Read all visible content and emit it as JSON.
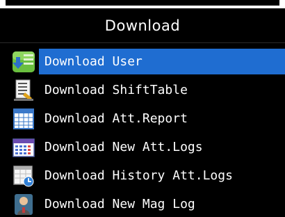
{
  "title": "Download",
  "menu": {
    "items": [
      {
        "label": "Download User",
        "icon": "user-download-icon",
        "selected": true
      },
      {
        "label": "Download ShiftTable",
        "icon": "shift-table-icon",
        "selected": false
      },
      {
        "label": "Download Att.Report",
        "icon": "report-grid-icon",
        "selected": false
      },
      {
        "label": "Download New Att.Logs",
        "icon": "calendar-logs-icon",
        "selected": false
      },
      {
        "label": "Download History Att.Logs",
        "icon": "history-calendar-icon",
        "selected": false
      },
      {
        "label": "Download New Mag Log",
        "icon": "person-icon",
        "selected": false
      }
    ]
  },
  "colors": {
    "selection": "#1f6dd1",
    "background": "#000000",
    "text": "#ffffff"
  }
}
